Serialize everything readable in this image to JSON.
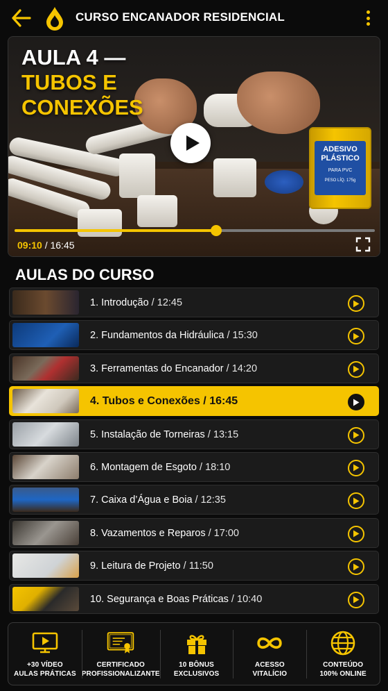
{
  "header": {
    "title": "CURSO ENCANADOR RESIDENCIAL",
    "accent": "#f5c400"
  },
  "video": {
    "title_line1": "AULA 4 —",
    "title_line2": "TUBOS E",
    "title_line3": "CONEXÕES",
    "current_time": "09:10",
    "separator": "/",
    "total_time": "16:45",
    "progress": 0.56,
    "can_line1": "ADESIVO",
    "can_line2": "PLÁSTICO",
    "can_line3": "PARA PVC",
    "can_line4": "PESO LÍQ. 175g"
  },
  "section_title": "AULAS DO CURSO",
  "lessons": [
    {
      "name": "1. Introdução",
      "duration": "12:45",
      "thumb": "instructor"
    },
    {
      "name": "2. Fundamentos da Hidráulica",
      "duration": "15:30",
      "thumb": "blueprint"
    },
    {
      "name": "3. Ferramentas do Encanador",
      "duration": "14:20",
      "thumb": "tools"
    },
    {
      "name": "4. Tubos e Conexões",
      "duration": "16:45",
      "thumb": "pipes",
      "active": true
    },
    {
      "name": "5. Instalação de Torneiras",
      "duration": "13:15",
      "thumb": "faucet"
    },
    {
      "name": "6. Montagem de Esgoto",
      "duration": "18:10",
      "thumb": "sewer"
    },
    {
      "name": "7. Caixa d’Água e Boia",
      "duration": "12:35",
      "thumb": "tank"
    },
    {
      "name": "8. Vazamentos e Reparos",
      "duration": "17:00",
      "thumb": "leak"
    },
    {
      "name": "9. Leitura de Projeto",
      "duration": "11:50",
      "thumb": "plan"
    },
    {
      "name": "10. Segurança e Boas Práticas",
      "duration": "10:40",
      "thumb": "safety"
    }
  ],
  "features": [
    {
      "line1": "+30 VÍDEO",
      "line2": "AULAS PRÁTICAS",
      "icon": "video-play-icon"
    },
    {
      "line1": "CERTIFICADO",
      "line2": "PROFISSIONALIZANTE",
      "icon": "certificate-icon"
    },
    {
      "line1": "10 BÔNUS",
      "line2": "EXCLUSIVOS",
      "icon": "gift-icon"
    },
    {
      "line1": "ACESSO",
      "line2": "VITALÍCIO",
      "icon": "infinity-icon"
    },
    {
      "line1": "CONTEÚDO",
      "line2": "100% ONLINE",
      "icon": "globe-icon"
    }
  ]
}
